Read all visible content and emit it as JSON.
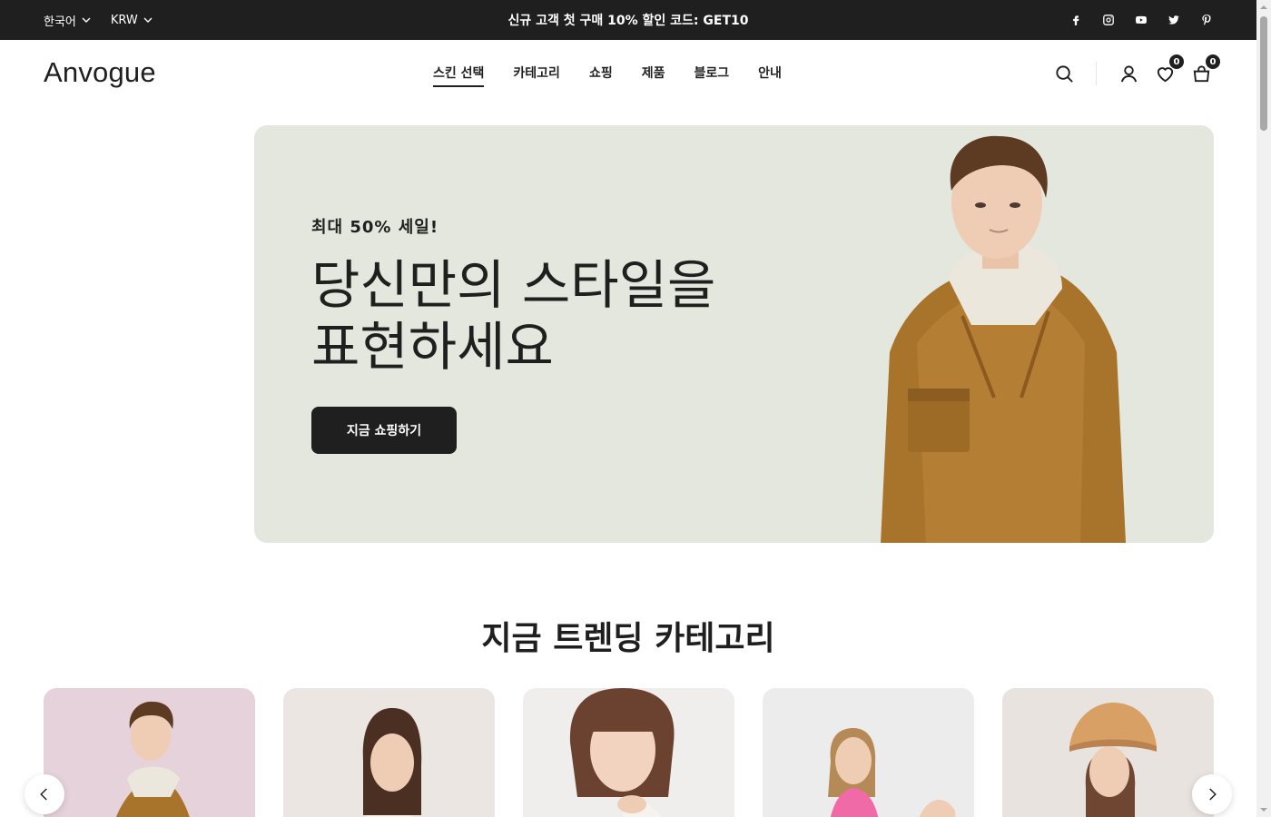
{
  "topbar": {
    "language": "한국어",
    "currency": "KRW",
    "promo": "신규 고객 첫 구매 10% 할인 코드: GET10",
    "social": [
      "facebook-icon",
      "instagram-icon",
      "youtube-icon",
      "twitter-icon",
      "pinterest-icon"
    ]
  },
  "header": {
    "logo": "Anvogue",
    "nav": [
      {
        "label": "스킨 선택",
        "active": true
      },
      {
        "label": "카테고리"
      },
      {
        "label": "쇼핑"
      },
      {
        "label": "제품"
      },
      {
        "label": "블로그"
      },
      {
        "label": "안내"
      }
    ],
    "wishlist_count": "0",
    "cart_count": "0"
  },
  "hero": {
    "eyebrow": "최대 50% 세일!",
    "title_line1": "당신만의 스타일을",
    "title_line2": "표현하세요",
    "cta": "지금 쇼핑하기",
    "bg_color": "#e4e7dd"
  },
  "trending": {
    "title": "지금 트렌딩 카테고리",
    "cards": [
      {
        "bg": "#e6d2db"
      },
      {
        "bg": "#ece6e3"
      },
      {
        "bg": "#f0eeec"
      },
      {
        "bg": "#ececec"
      },
      {
        "bg": "#e8e3df"
      }
    ]
  },
  "colors": {
    "dark": "#1f1f1f",
    "white": "#ffffff"
  }
}
